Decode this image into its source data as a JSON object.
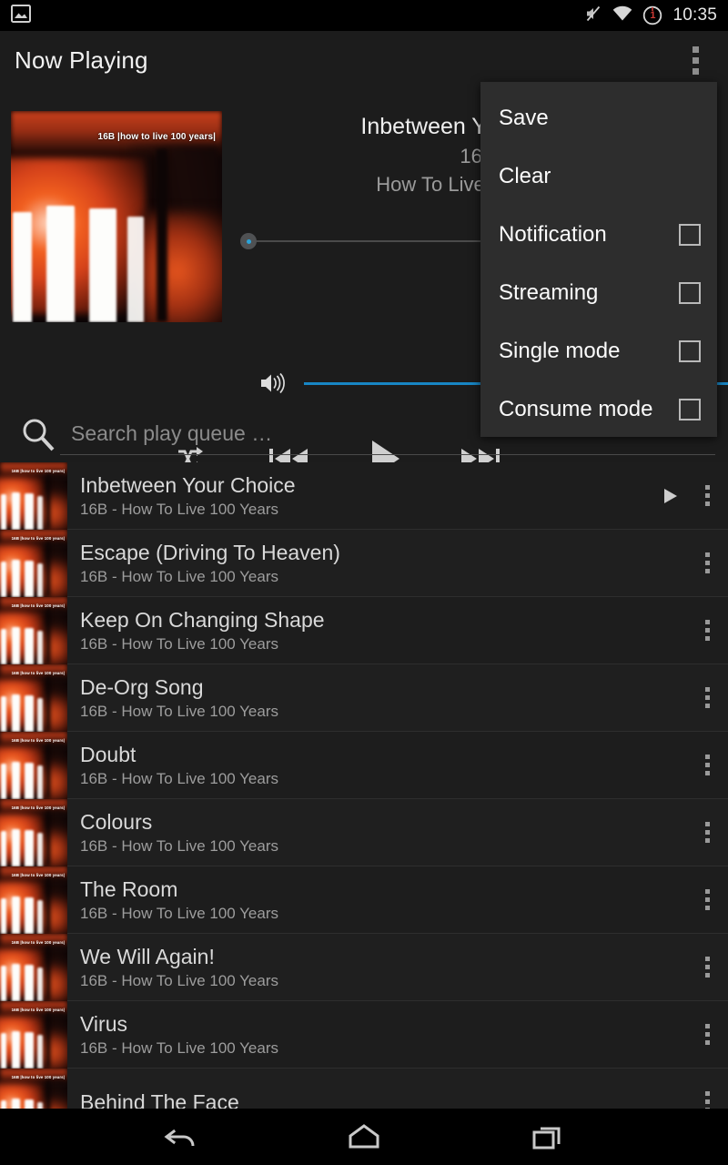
{
  "statusbar": {
    "time": "10:35",
    "badge_count": "1",
    "icons": [
      "gallery-icon",
      "mute-icon",
      "wifi-icon",
      "alarm-badge-icon"
    ]
  },
  "actionbar": {
    "title": "Now Playing",
    "overflow_icon": "overflow-menu-icon"
  },
  "now_playing": {
    "album_art_label": "16B |how to live 100 years|",
    "track_title": "Inbetween Your Choice",
    "artist": "16B",
    "album": "How To Live 100 Years",
    "seek_position_percent": 0,
    "volume_percent": 100,
    "controls": {
      "shuffle": "shuffle-icon",
      "previous": "previous-track-icon",
      "play": "play-icon",
      "next": "next-track-icon"
    },
    "volume_icon": "volume-up-icon"
  },
  "search": {
    "placeholder": "Search play queue …",
    "value": "",
    "icon": "search-icon"
  },
  "popup_menu": {
    "items": [
      {
        "label": "Save",
        "has_checkbox": false,
        "checked": false
      },
      {
        "label": "Clear",
        "has_checkbox": false,
        "checked": false
      },
      {
        "label": "Notification",
        "has_checkbox": true,
        "checked": false
      },
      {
        "label": "Streaming",
        "has_checkbox": true,
        "checked": false
      },
      {
        "label": "Single mode",
        "has_checkbox": true,
        "checked": false
      },
      {
        "label": "Consume mode",
        "has_checkbox": true,
        "checked": false
      }
    ]
  },
  "queue": {
    "thumb_label": "16B |how to live 100 years|",
    "rows": [
      {
        "title": "Inbetween Your Choice",
        "subtitle": "16B - How To Live 100 Years",
        "playing": true
      },
      {
        "title": "Escape (Driving To Heaven)",
        "subtitle": "16B - How To Live 100 Years",
        "playing": false
      },
      {
        "title": "Keep On Changing Shape",
        "subtitle": "16B - How To Live 100 Years",
        "playing": false
      },
      {
        "title": "De-Org Song",
        "subtitle": "16B - How To Live 100 Years",
        "playing": false
      },
      {
        "title": "Doubt",
        "subtitle": "16B - How To Live 100 Years",
        "playing": false
      },
      {
        "title": "Colours",
        "subtitle": "16B - How To Live 100 Years",
        "playing": false
      },
      {
        "title": "The Room",
        "subtitle": "16B - How To Live 100 Years",
        "playing": false
      },
      {
        "title": "We Will Again!",
        "subtitle": "16B - How To Live 100 Years",
        "playing": false
      },
      {
        "title": "Virus",
        "subtitle": "16B - How To Live 100 Years",
        "playing": false
      },
      {
        "title": "Behind The Face",
        "subtitle": "",
        "playing": false
      }
    ]
  },
  "navbar": {
    "back": "back-icon",
    "home": "home-icon",
    "recents": "recents-icon"
  },
  "colors": {
    "background": "#1c1c1c",
    "statusbar_bg": "#000000",
    "menu_bg": "#2d2d2d",
    "accent_blue": "#1886c4",
    "text_primary": "#f2f2f2",
    "text_secondary": "#9b9b9b",
    "badge_red": "#d03a34"
  }
}
